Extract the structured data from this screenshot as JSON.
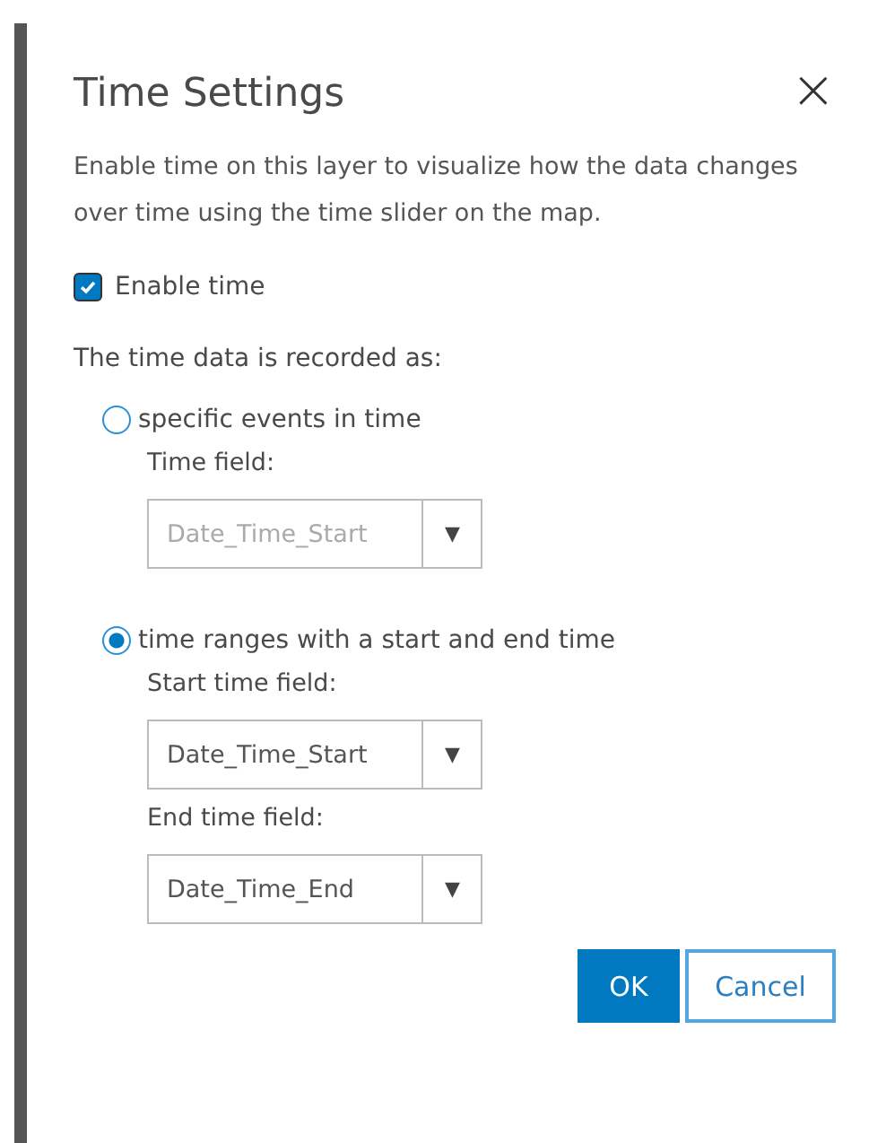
{
  "dialog": {
    "title": "Time Settings",
    "close": "×",
    "description": "Enable time on this layer to visualize how the data changes over time using the time slider on the map."
  },
  "enable_time": {
    "label": "Enable time",
    "checked": true
  },
  "recorded_as": {
    "label": "The time data is recorded as:",
    "options": [
      {
        "label": "specific events in time",
        "selected": false,
        "fields": [
          {
            "label": "Time field:",
            "value": "Date_Time_Start",
            "disabled": true,
            "arrow": "▼"
          }
        ]
      },
      {
        "label": "time ranges with a start and end time",
        "selected": true,
        "fields": [
          {
            "label": "Start time field:",
            "value": "Date_Time_Start",
            "disabled": false,
            "arrow": "▼"
          },
          {
            "label": "End time field:",
            "value": "Date_Time_End",
            "disabled": false,
            "arrow": "▼"
          }
        ]
      }
    ]
  },
  "buttons": [
    {
      "label": "OK",
      "kind": "primary"
    },
    {
      "label": "Cancel",
      "kind": "secondary"
    }
  ]
}
